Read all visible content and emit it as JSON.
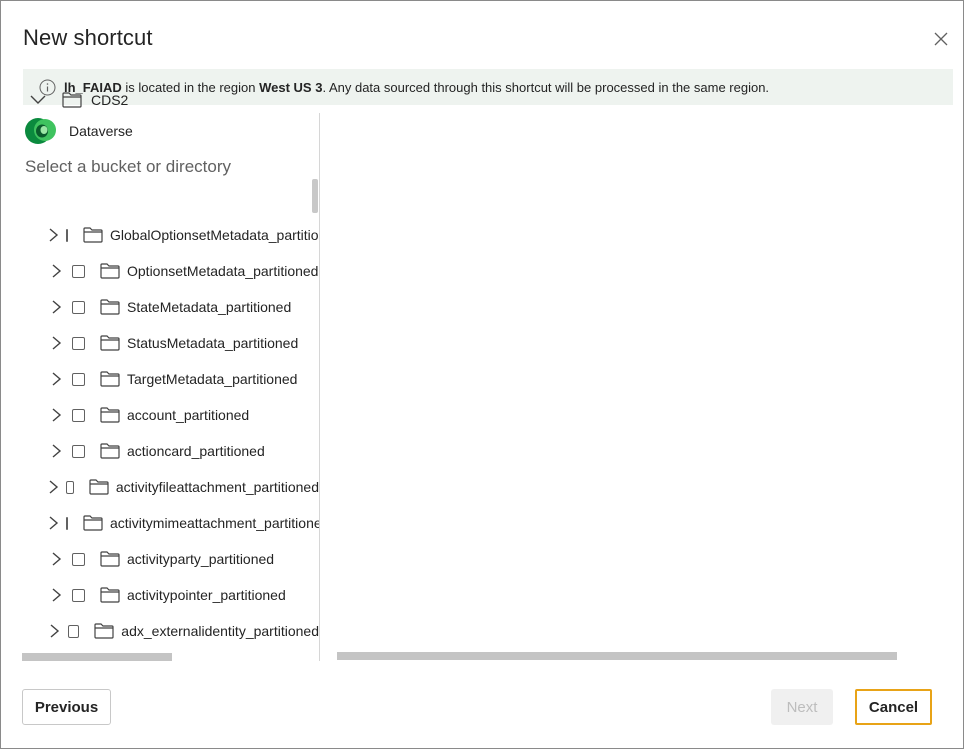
{
  "dialog": {
    "title": "New shortcut",
    "close_icon": "close-icon"
  },
  "info_bar": {
    "icon": "info-icon",
    "lakehouse": "lh_FAIAD",
    "text_1": " is located in the region ",
    "region": "West US 3",
    "text_2": ". Any data sourced through this shortcut will be processed in the same region."
  },
  "source": {
    "name": "Dataverse",
    "icon": "dataverse-logo-icon",
    "brand_color": "#0b8a3e"
  },
  "browser": {
    "select_label": "Select a bucket or directory",
    "root": {
      "label": "CDS2",
      "expanded": true
    },
    "items": [
      {
        "label": "GlobalOptionsetMetadata_partitioned"
      },
      {
        "label": "OptionsetMetadata_partitioned"
      },
      {
        "label": "StateMetadata_partitioned"
      },
      {
        "label": "StatusMetadata_partitioned"
      },
      {
        "label": "TargetMetadata_partitioned"
      },
      {
        "label": "account_partitioned"
      },
      {
        "label": "actioncard_partitioned"
      },
      {
        "label": "activityfileattachment_partitioned"
      },
      {
        "label": "activitymimeattachment_partitioned"
      },
      {
        "label": "activityparty_partitioned"
      },
      {
        "label": "activitypointer_partitioned"
      },
      {
        "label": "adx_externalidentity_partitioned"
      }
    ]
  },
  "footer": {
    "previous_label": "Previous",
    "next_label": "Next",
    "cancel_label": "Cancel",
    "focus_color": "#e8a317"
  }
}
